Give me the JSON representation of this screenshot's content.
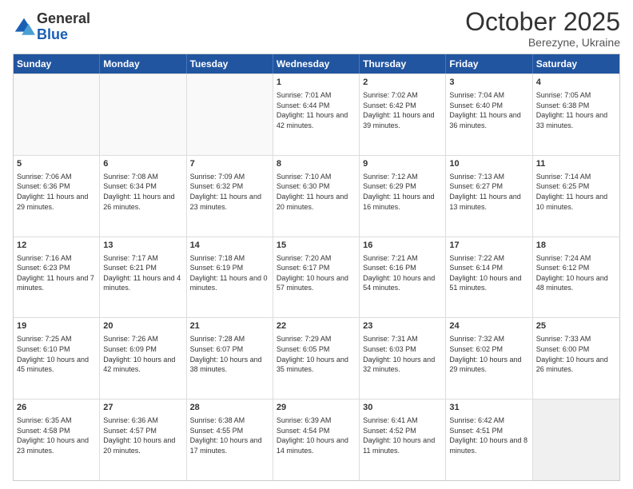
{
  "logo": {
    "general": "General",
    "blue": "Blue"
  },
  "title": "October 2025",
  "location": "Berezyne, Ukraine",
  "days": [
    "Sunday",
    "Monday",
    "Tuesday",
    "Wednesday",
    "Thursday",
    "Friday",
    "Saturday"
  ],
  "rows": [
    [
      {
        "day": "",
        "info": ""
      },
      {
        "day": "",
        "info": ""
      },
      {
        "day": "",
        "info": ""
      },
      {
        "day": "1",
        "info": "Sunrise: 7:01 AM\nSunset: 6:44 PM\nDaylight: 11 hours and 42 minutes."
      },
      {
        "day": "2",
        "info": "Sunrise: 7:02 AM\nSunset: 6:42 PM\nDaylight: 11 hours and 39 minutes."
      },
      {
        "day": "3",
        "info": "Sunrise: 7:04 AM\nSunset: 6:40 PM\nDaylight: 11 hours and 36 minutes."
      },
      {
        "day": "4",
        "info": "Sunrise: 7:05 AM\nSunset: 6:38 PM\nDaylight: 11 hours and 33 minutes."
      }
    ],
    [
      {
        "day": "5",
        "info": "Sunrise: 7:06 AM\nSunset: 6:36 PM\nDaylight: 11 hours and 29 minutes."
      },
      {
        "day": "6",
        "info": "Sunrise: 7:08 AM\nSunset: 6:34 PM\nDaylight: 11 hours and 26 minutes."
      },
      {
        "day": "7",
        "info": "Sunrise: 7:09 AM\nSunset: 6:32 PM\nDaylight: 11 hours and 23 minutes."
      },
      {
        "day": "8",
        "info": "Sunrise: 7:10 AM\nSunset: 6:30 PM\nDaylight: 11 hours and 20 minutes."
      },
      {
        "day": "9",
        "info": "Sunrise: 7:12 AM\nSunset: 6:29 PM\nDaylight: 11 hours and 16 minutes."
      },
      {
        "day": "10",
        "info": "Sunrise: 7:13 AM\nSunset: 6:27 PM\nDaylight: 11 hours and 13 minutes."
      },
      {
        "day": "11",
        "info": "Sunrise: 7:14 AM\nSunset: 6:25 PM\nDaylight: 11 hours and 10 minutes."
      }
    ],
    [
      {
        "day": "12",
        "info": "Sunrise: 7:16 AM\nSunset: 6:23 PM\nDaylight: 11 hours and 7 minutes."
      },
      {
        "day": "13",
        "info": "Sunrise: 7:17 AM\nSunset: 6:21 PM\nDaylight: 11 hours and 4 minutes."
      },
      {
        "day": "14",
        "info": "Sunrise: 7:18 AM\nSunset: 6:19 PM\nDaylight: 11 hours and 0 minutes."
      },
      {
        "day": "15",
        "info": "Sunrise: 7:20 AM\nSunset: 6:17 PM\nDaylight: 10 hours and 57 minutes."
      },
      {
        "day": "16",
        "info": "Sunrise: 7:21 AM\nSunset: 6:16 PM\nDaylight: 10 hours and 54 minutes."
      },
      {
        "day": "17",
        "info": "Sunrise: 7:22 AM\nSunset: 6:14 PM\nDaylight: 10 hours and 51 minutes."
      },
      {
        "day": "18",
        "info": "Sunrise: 7:24 AM\nSunset: 6:12 PM\nDaylight: 10 hours and 48 minutes."
      }
    ],
    [
      {
        "day": "19",
        "info": "Sunrise: 7:25 AM\nSunset: 6:10 PM\nDaylight: 10 hours and 45 minutes."
      },
      {
        "day": "20",
        "info": "Sunrise: 7:26 AM\nSunset: 6:09 PM\nDaylight: 10 hours and 42 minutes."
      },
      {
        "day": "21",
        "info": "Sunrise: 7:28 AM\nSunset: 6:07 PM\nDaylight: 10 hours and 38 minutes."
      },
      {
        "day": "22",
        "info": "Sunrise: 7:29 AM\nSunset: 6:05 PM\nDaylight: 10 hours and 35 minutes."
      },
      {
        "day": "23",
        "info": "Sunrise: 7:31 AM\nSunset: 6:03 PM\nDaylight: 10 hours and 32 minutes."
      },
      {
        "day": "24",
        "info": "Sunrise: 7:32 AM\nSunset: 6:02 PM\nDaylight: 10 hours and 29 minutes."
      },
      {
        "day": "25",
        "info": "Sunrise: 7:33 AM\nSunset: 6:00 PM\nDaylight: 10 hours and 26 minutes."
      }
    ],
    [
      {
        "day": "26",
        "info": "Sunrise: 6:35 AM\nSunset: 4:58 PM\nDaylight: 10 hours and 23 minutes."
      },
      {
        "day": "27",
        "info": "Sunrise: 6:36 AM\nSunset: 4:57 PM\nDaylight: 10 hours and 20 minutes."
      },
      {
        "day": "28",
        "info": "Sunrise: 6:38 AM\nSunset: 4:55 PM\nDaylight: 10 hours and 17 minutes."
      },
      {
        "day": "29",
        "info": "Sunrise: 6:39 AM\nSunset: 4:54 PM\nDaylight: 10 hours and 14 minutes."
      },
      {
        "day": "30",
        "info": "Sunrise: 6:41 AM\nSunset: 4:52 PM\nDaylight: 10 hours and 11 minutes."
      },
      {
        "day": "31",
        "info": "Sunrise: 6:42 AM\nSunset: 4:51 PM\nDaylight: 10 hours and 8 minutes."
      },
      {
        "day": "",
        "info": ""
      }
    ]
  ]
}
